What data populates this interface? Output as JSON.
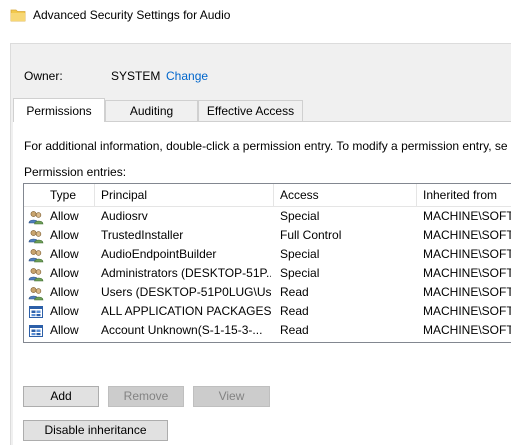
{
  "window": {
    "title": "Advanced Security Settings for Audio",
    "icon": "folder-icon"
  },
  "owner": {
    "label": "Owner:",
    "value": "SYSTEM",
    "change_link": "Change"
  },
  "tabs": [
    {
      "label": "Permissions",
      "active": true
    },
    {
      "label": "Auditing",
      "active": false
    },
    {
      "label": "Effective Access",
      "active": false
    }
  ],
  "permissions": {
    "info_text": "For additional information, double-click a permission entry. To modify a permission entry, se",
    "entries_label": "Permission entries:",
    "columns": [
      "Type",
      "Principal",
      "Access",
      "Inherited from"
    ],
    "rows": [
      {
        "icon": "users-icon",
        "type": "Allow",
        "principal": "Audiosrv",
        "access": "Special",
        "inherited_from": "MACHINE\\SOFTW"
      },
      {
        "icon": "users-icon",
        "type": "Allow",
        "principal": "TrustedInstaller",
        "access": "Full Control",
        "inherited_from": "MACHINE\\SOFTW"
      },
      {
        "icon": "users-icon",
        "type": "Allow",
        "principal": "AudioEndpointBuilder",
        "access": "Special",
        "inherited_from": "MACHINE\\SOFTW"
      },
      {
        "icon": "users-icon",
        "type": "Allow",
        "principal": "Administrators (DESKTOP-51P...",
        "access": "Special",
        "inherited_from": "MACHINE\\SOFTW"
      },
      {
        "icon": "users-icon",
        "type": "Allow",
        "principal": "Users (DESKTOP-51P0LUG\\Us...",
        "access": "Read",
        "inherited_from": "MACHINE\\SOFTW"
      },
      {
        "icon": "app-packages-icon",
        "type": "Allow",
        "principal": "ALL APPLICATION PACKAGES",
        "access": "Read",
        "inherited_from": "MACHINE\\SOFTW"
      },
      {
        "icon": "app-packages-icon",
        "type": "Allow",
        "principal": "Account Unknown(S-1-15-3-...",
        "access": "Read",
        "inherited_from": "MACHINE\\SOFTW"
      }
    ]
  },
  "buttons": {
    "add": "Add",
    "remove": "Remove",
    "view": "View",
    "disable_inheritance": "Disable inheritance"
  },
  "colors": {
    "link": "#0066cc",
    "folder": "#f2c94c"
  }
}
